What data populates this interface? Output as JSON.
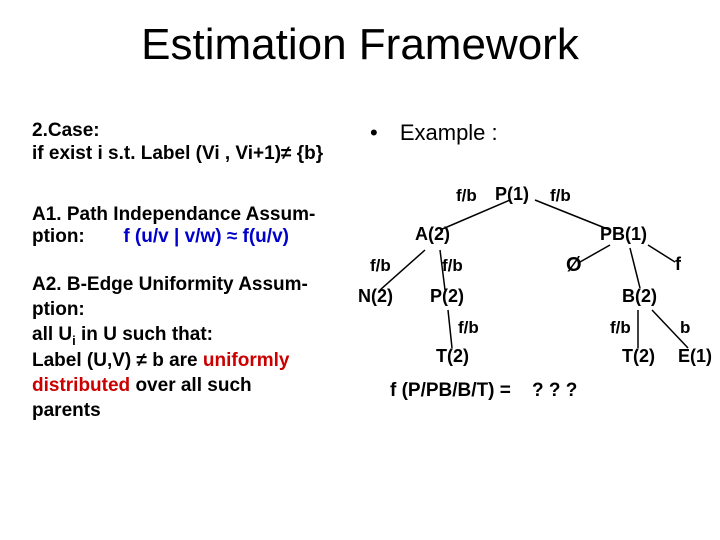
{
  "title": "Estimation Framework",
  "case": {
    "line1": "2.Case:",
    "line2": "if exist i  s.t.  Label (Vi , Vi+1)≠ {b}"
  },
  "a1": {
    "heading": "A1. Path Independance Assum-",
    "line2a": "ption:",
    "line2b": "f (u/v | v/w) ≈ f(u/v)"
  },
  "a2": {
    "heading": "A2. B-Edge Uniformity Assum-",
    "line2": "ption:",
    "line3a": "all U",
    "line3sub": "i",
    "line3b": " in U such that:",
    "line4a": "Label (U,V) ≠ b  are ",
    "line4b": "uniformly",
    "line5a": "distributed",
    "line5b": "  over all  such",
    "line6": "parents"
  },
  "example": {
    "bullet": "•",
    "label": "Example :"
  },
  "tree": {
    "root": "P(1)",
    "left_child": "A(2)",
    "right_child": "PB(1)",
    "n2": "N(2)",
    "p2": "P(2)",
    "b2": "B(2)",
    "empty": "Ø",
    "f_leaf": "f",
    "t2_left": "T(2)",
    "t2_right": "T(2)",
    "e1": "E(1)",
    "edge_fb": "f/b",
    "edge_b": "b"
  },
  "formula": {
    "lhs": "f (P/PB/B/T) =",
    "rhs": "? ? ?"
  }
}
